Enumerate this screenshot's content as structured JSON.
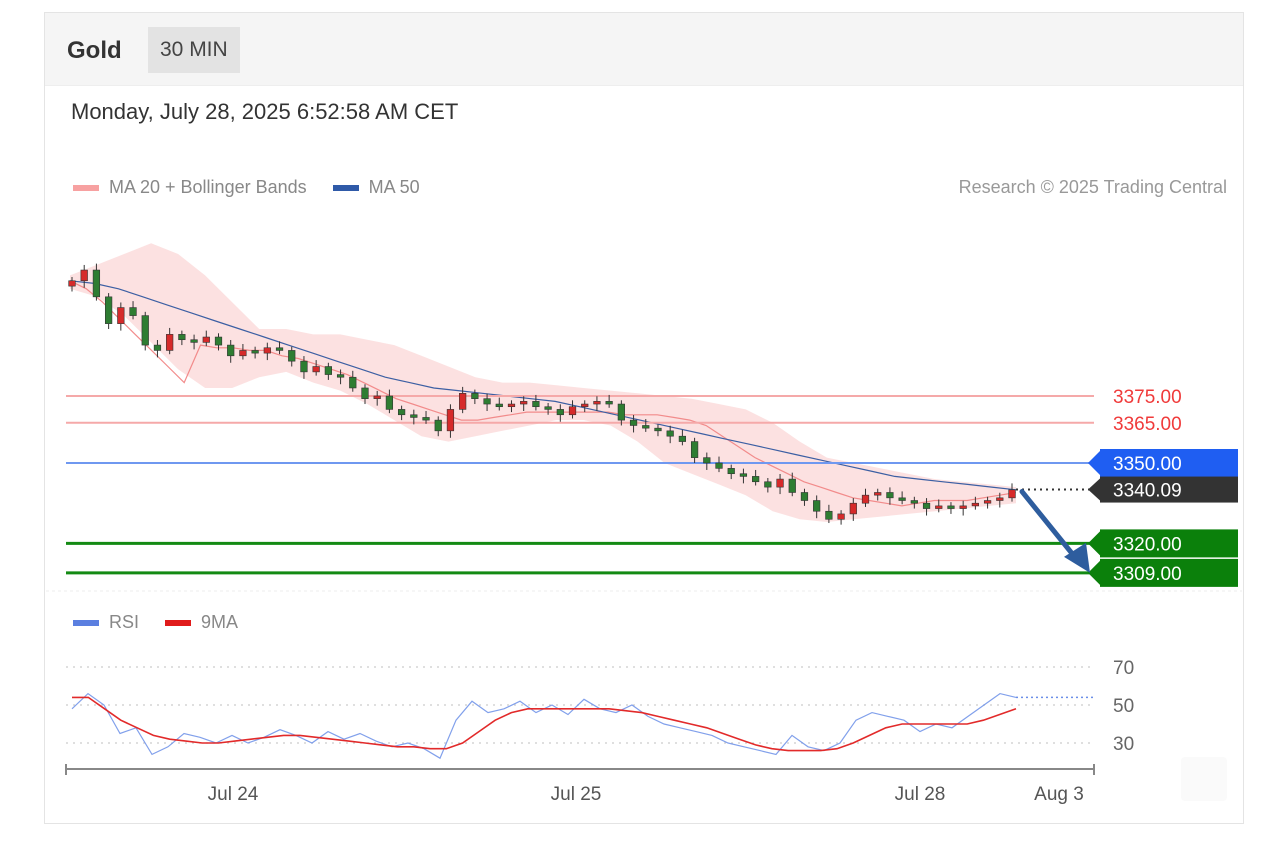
{
  "header": {
    "title": "Gold",
    "timeframe": "30 MIN"
  },
  "datetime": "Monday, July 28, 2025 6:52:58 AM CET",
  "credit": "Research © 2025 Trading Central",
  "legend_price": [
    {
      "label": "MA 20 + Bollinger Bands",
      "color": "#f7a1a1"
    },
    {
      "label": "MA 50",
      "color": "#2f5aa8"
    }
  ],
  "legend_rsi": [
    {
      "label": "RSI",
      "color": "#5b7fe0"
    },
    {
      "label": "9MA",
      "color": "#e01b1b"
    }
  ],
  "chart_data": [
    {
      "type": "candlestick",
      "title": "Gold 30 MIN",
      "ylim": [
        3305,
        3425
      ],
      "x_ticks": [
        "Jul 24",
        "Jul 25",
        "Jul 28",
        "Aug 3"
      ],
      "current_price": {
        "value": 3340.09,
        "label": "3340.09",
        "color": "#333333"
      },
      "levels": [
        {
          "label": "3375.00",
          "value": 3375.0,
          "kind": "resistance",
          "color": "#f03a3a",
          "tag": false
        },
        {
          "label": "3365.00",
          "value": 3365.0,
          "kind": "resistance",
          "color": "#f03a3a",
          "tag": false
        },
        {
          "label": "3350.00",
          "value": 3350.0,
          "kind": "pivot",
          "color": "#2f6bf0",
          "tag": true
        },
        {
          "label": "3320.00",
          "value": 3320.0,
          "kind": "support",
          "color": "#0a8a0a",
          "tag": true
        },
        {
          "label": "3309.00",
          "value": 3309.0,
          "kind": "support",
          "color": "#0a8a0a",
          "tag": true
        }
      ],
      "close": [
        3418,
        3422,
        3412,
        3402,
        3408,
        3405,
        3394,
        3392,
        3398,
        3396,
        3395,
        3397,
        3394,
        3390,
        3392,
        3391,
        3393,
        3392,
        3388,
        3384,
        3386,
        3383,
        3382,
        3378,
        3374,
        3375,
        3370,
        3368,
        3367,
        3366,
        3362,
        3370,
        3376,
        3374,
        3372,
        3371,
        3372,
        3373,
        3371,
        3370,
        3368,
        3371,
        3372,
        3373,
        3372,
        3366,
        3364,
        3363,
        3362,
        3360,
        3358,
        3352,
        3350,
        3348,
        3346,
        3345,
        3343,
        3341,
        3344,
        3339,
        3336,
        3332,
        3329,
        3331,
        3335,
        3338,
        3339,
        3337,
        3336,
        3335,
        3333,
        3334,
        3333,
        3334,
        3335,
        3336,
        3337,
        3340
      ],
      "ma20": [
        3418,
        3415,
        3410,
        3404,
        3398,
        3392,
        3386,
        3380,
        3394,
        3393,
        3393,
        3392,
        3392,
        3390,
        3389,
        3387,
        3385,
        3383,
        3380,
        3377,
        3374,
        3372,
        3370,
        3368,
        3366,
        3366,
        3367,
        3368,
        3369,
        3369,
        3369,
        3369,
        3369,
        3369,
        3368,
        3368,
        3368,
        3367,
        3366,
        3364,
        3360,
        3356,
        3352,
        3349,
        3346,
        3343,
        3341,
        3339,
        3337,
        3336,
        3335,
        3334,
        3335,
        3336,
        3336,
        3336,
        3337,
        3338,
        3339
      ],
      "ma50": [
        3418,
        3417,
        3415,
        3412,
        3409,
        3406,
        3403,
        3400,
        3397,
        3394,
        3391,
        3388,
        3385,
        3382,
        3380,
        3378,
        3377,
        3376,
        3375,
        3374,
        3373,
        3371,
        3369,
        3367,
        3365,
        3363,
        3361,
        3359,
        3357,
        3355,
        3353,
        3351,
        3349,
        3347,
        3345,
        3344,
        3343,
        3342,
        3341,
        3340
      ],
      "bb_upper": [
        3420,
        3424,
        3428,
        3432,
        3428,
        3420,
        3410,
        3400,
        3400,
        3398,
        3398,
        3396,
        3394,
        3390,
        3386,
        3382,
        3380,
        3380,
        3379,
        3378,
        3377,
        3376,
        3375,
        3374,
        3372,
        3370,
        3365,
        3358,
        3352,
        3350,
        3348,
        3346,
        3344,
        3343,
        3342,
        3341
      ],
      "bb_lower": [
        3415,
        3412,
        3405,
        3395,
        3385,
        3378,
        3378,
        3382,
        3384,
        3380,
        3377,
        3372,
        3366,
        3360,
        3358,
        3360,
        3362,
        3364,
        3366,
        3366,
        3364,
        3358,
        3350,
        3346,
        3342,
        3338,
        3332,
        3329,
        3328,
        3329,
        3330,
        3331,
        3332,
        3333,
        3334,
        3335
      ],
      "forecast_arrow": {
        "from": 3340.09,
        "to": 3309.0,
        "color": "#2e5d9e"
      }
    },
    {
      "type": "line",
      "title": "RSI",
      "ylim": [
        20,
        80
      ],
      "y_ticks": [
        "70",
        "50",
        "30"
      ],
      "series": [
        {
          "name": "RSI",
          "color": "#6b8fe8",
          "values": [
            48,
            56,
            50,
            35,
            38,
            24,
            28,
            35,
            33,
            30,
            34,
            30,
            33,
            37,
            34,
            30,
            36,
            32,
            35,
            31,
            28,
            30,
            27,
            22,
            42,
            52,
            46,
            48,
            52,
            46,
            50,
            45,
            53,
            48,
            46,
            50,
            44,
            40,
            38,
            36,
            34,
            30,
            28,
            26,
            24,
            34,
            28,
            26,
            30,
            42,
            46,
            44,
            42,
            36,
            40,
            38,
            44,
            50,
            56,
            54
          ]
        },
        {
          "name": "9MA",
          "color": "#e22a2a",
          "values": [
            54,
            54,
            48,
            42,
            38,
            34,
            32,
            31,
            30,
            30,
            31,
            32,
            33,
            34,
            34,
            33,
            32,
            31,
            30,
            29,
            28,
            28,
            27,
            27,
            30,
            36,
            42,
            46,
            48,
            48,
            48,
            48,
            48,
            48,
            47,
            46,
            44,
            42,
            40,
            38,
            35,
            32,
            29,
            27,
            26,
            26,
            26,
            27,
            30,
            34,
            38,
            40,
            40,
            40,
            40,
            40,
            42,
            45,
            48
          ]
        }
      ]
    }
  ]
}
